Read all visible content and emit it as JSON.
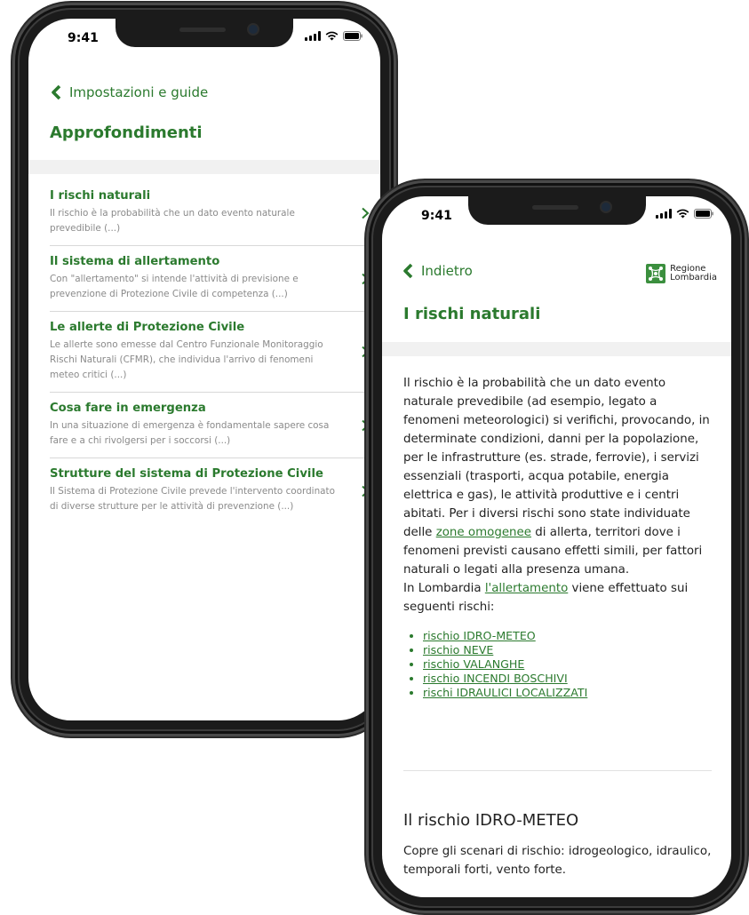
{
  "status": {
    "time": "9:41"
  },
  "screen1": {
    "back_label": "Impostazioni e guide",
    "title": "Approfondimenti",
    "items": [
      {
        "title": "I rischi naturali",
        "desc": "Il rischio è la probabilità che un dato evento naturale prevedibile (...)"
      },
      {
        "title": "Il sistema di allertamento",
        "desc": "Con \"allertamento\" si intende l'attività di previsione e prevenzione di Protezione Civile di competenza (...)"
      },
      {
        "title": "Le allerte di Protezione Civile",
        "desc": "Le allerte sono emesse dal Centro Funzionale Monitoraggio Rischi Naturali (CFMR), che individua l'arrivo di fenomeni meteo critici (...)"
      },
      {
        "title": "Cosa fare in emergenza",
        "desc": "In una situazione di emergenza è fondamentale sapere cosa fare e a chi rivolgersi per i soccorsi (...)"
      },
      {
        "title": "Strutture del sistema di Protezione Civile",
        "desc": "Il Sistema di Protezione Civile prevede l'intervento coordinato di diverse strutture per le attività di prevenzione (...)"
      }
    ]
  },
  "screen2": {
    "back_label": "Indietro",
    "logo_line1": "Regione",
    "logo_line2": "Lombardia",
    "title": "I rischi naturali",
    "intro_part1": "Il rischio è la probabilità che un dato evento naturale prevedibile (ad esempio, legato a fenomeni meteorologici) si verifichi, provocando, in determinate condizioni, danni per la popolazione, per le infrastrutture (es. strade, ferrovie), i servizi essenziali (trasporti, acqua potabile, energia elettrica e gas), le attività produttive e i centri abitati. Per i diversi rischi sono state individuate delle ",
    "intro_link": "zone omogenee",
    "intro_part2": " di allerta, territori dove i fenomeni previsti causano effetti simili, per fattori naturali o legati alla presenza umana.",
    "lombardia_part1": "In Lombardia ",
    "lombardia_link": "l'allertamento",
    "lombardia_part2": " viene effettuato sui seguenti rischi:",
    "risks": [
      "rischio IDRO-METEO",
      "rischio NEVE",
      "rischio VALANGHE",
      "rischio INCENDI BOSCHIVI",
      "rischi IDRAULICI LOCALIZZATI"
    ],
    "section_title": "Il rischio IDRO-METEO",
    "section_text": "Copre gli scenari di rischio: idrogeologico, idraulico, temporali forti, vento forte."
  },
  "colors": {
    "accent": "#2b7a2e",
    "logo_green": "#3b8f3e"
  }
}
